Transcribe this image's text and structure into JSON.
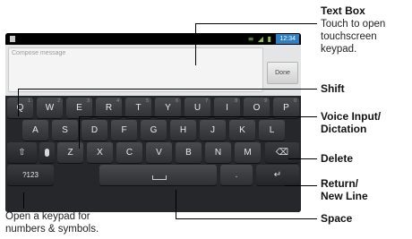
{
  "statusbar": {
    "time": "12:34",
    "icons": "≡ ◢ ▮"
  },
  "compose": {
    "placeholder": "Compose message",
    "done_label": "Done"
  },
  "keyboard": {
    "row1": [
      {
        "label": "Q",
        "sub": "1"
      },
      {
        "label": "W",
        "sub": "2"
      },
      {
        "label": "E",
        "sub": "3"
      },
      {
        "label": "R",
        "sub": "4"
      },
      {
        "label": "T",
        "sub": "5"
      },
      {
        "label": "Y",
        "sub": "6"
      },
      {
        "label": "U",
        "sub": "7"
      },
      {
        "label": "I",
        "sub": "8"
      },
      {
        "label": "O",
        "sub": "9"
      },
      {
        "label": "P",
        "sub": "0"
      }
    ],
    "row2": [
      "A",
      "S",
      "D",
      "F",
      "G",
      "H",
      "J",
      "K",
      "L"
    ],
    "row3": [
      "Z",
      "X",
      "C",
      "V",
      "B",
      "N",
      "M"
    ],
    "shift_glyph": "⇧",
    "delete_glyph": "⌫",
    "numbers_label": "?123",
    "period_label": ".",
    "return_glyph": "↵"
  },
  "annotations": {
    "text_box_title": "Text Box",
    "text_box_desc_1": "Touch to open",
    "text_box_desc_2": "touchscreen",
    "text_box_desc_3": "keypad.",
    "shift": "Shift",
    "voice_1": "Voice Input/",
    "voice_2": "Dictation",
    "delete": "Delete",
    "return_1": "Return/",
    "return_2": "New Line",
    "space": "Space",
    "keypad_1": "Open a keypad for",
    "keypad_2": "numbers & symbols."
  }
}
